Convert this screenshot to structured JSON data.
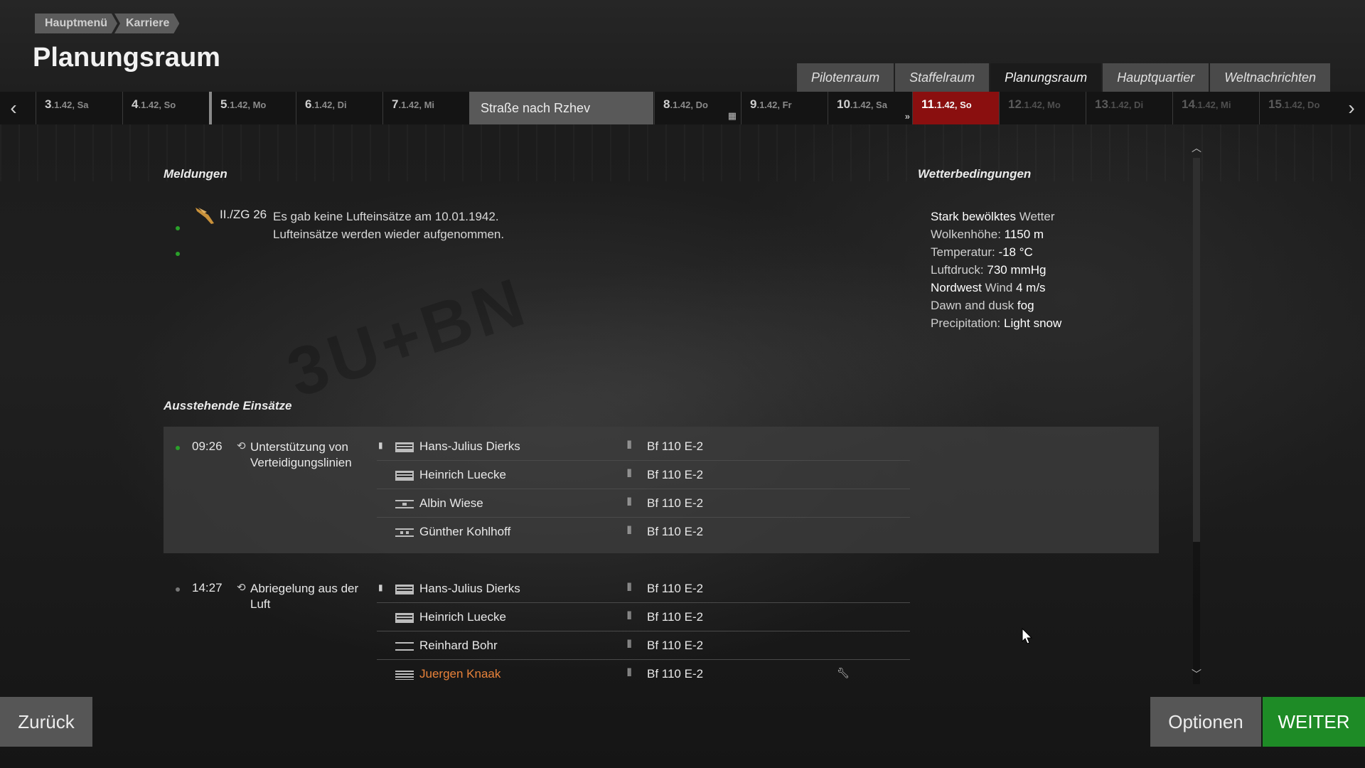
{
  "breadcrumb": [
    "Hauptmenü",
    "Karriere"
  ],
  "page_title": "Planungsraum",
  "tabs": [
    {
      "label": "Pilotenraum",
      "active": false
    },
    {
      "label": "Staffelraum",
      "active": false
    },
    {
      "label": "Planungsraum",
      "active": true
    },
    {
      "label": "Hauptquartier",
      "active": false
    },
    {
      "label": "Weltnachrichten",
      "active": false
    }
  ],
  "calendar": {
    "campaign_banner": "Straße nach Rzhev",
    "days": [
      {
        "day": "3",
        "rest": ".1.42, Sa"
      },
      {
        "day": "4",
        "rest": ".1.42, So"
      },
      {
        "day": "5",
        "rest": ".1.42, Mo"
      },
      {
        "day": "6",
        "rest": ".1.42, Di"
      },
      {
        "day": "7",
        "rest": ".1.42, Mi"
      },
      {
        "day": "8",
        "rest": ".1.42, Do"
      },
      {
        "day": "9",
        "rest": ".1.42, Fr"
      },
      {
        "day": "10",
        "rest": ".1.42, Sa"
      },
      {
        "day": "11",
        "rest": ".1.42, So"
      },
      {
        "day": "12",
        "rest": ".1.42, Mo"
      },
      {
        "day": "13",
        "rest": ".1.42, Di"
      },
      {
        "day": "14",
        "rest": ".1.42, Mi"
      },
      {
        "day": "15",
        "rest": ".1.42, Do"
      }
    ]
  },
  "messages": {
    "title": "Meldungen",
    "unit": "II./ZG 26",
    "line1": "Es gab keine Lufteinsätze am 10.01.1942.",
    "line2": "Lufteinsätze werden wieder aufgenommen."
  },
  "weather": {
    "title": "Wetterbedingungen",
    "cloud_value": "Stark bewölktes",
    "cloud_label": " Wetter",
    "height_label": "Wolkenhöhe: ",
    "height_value": "1150 m",
    "temp_label": "Temperatur: ",
    "temp_value": "-18 °C",
    "pressure_label": "Luftdruck: ",
    "pressure_value": "730 mmHg",
    "wind_dir": "Nordwest",
    "wind_label": " Wind ",
    "wind_value": "4 m/s",
    "fog_label": "Dawn and dusk ",
    "fog_value": "fog",
    "precip_label": "Precipitation: ",
    "precip_value": "Light snow"
  },
  "missions": {
    "title": "Ausstehende Einsätze",
    "items": [
      {
        "time": "09:26",
        "name": "Unterstützung von Verteidigungslinien",
        "pilots": [
          {
            "name": "Hans-Julius Dierks",
            "plane": "Bf 110 E-2"
          },
          {
            "name": "Heinrich Luecke",
            "plane": "Bf 110 E-2"
          },
          {
            "name": "Albin Wiese",
            "plane": "Bf 110 E-2"
          },
          {
            "name": "Günther Kohlhoff",
            "plane": "Bf 110 E-2"
          }
        ]
      },
      {
        "time": "14:27",
        "name": "Abriegelung aus der Luft",
        "pilots": [
          {
            "name": "Hans-Julius Dierks",
            "plane": "Bf 110 E-2"
          },
          {
            "name": "Heinrich Luecke",
            "plane": "Bf 110 E-2"
          },
          {
            "name": "Reinhard Bohr",
            "plane": "Bf 110 E-2"
          },
          {
            "name": "Juergen Knaak",
            "plane": "Bf 110 E-2"
          }
        ]
      }
    ]
  },
  "buttons": {
    "back": "Zurück",
    "options": "Optionen",
    "next": "WEITER"
  },
  "colors": {
    "accent_green": "#1e8b26",
    "today_red": "#8a0f0f",
    "highlight_orange": "#e8823a"
  }
}
